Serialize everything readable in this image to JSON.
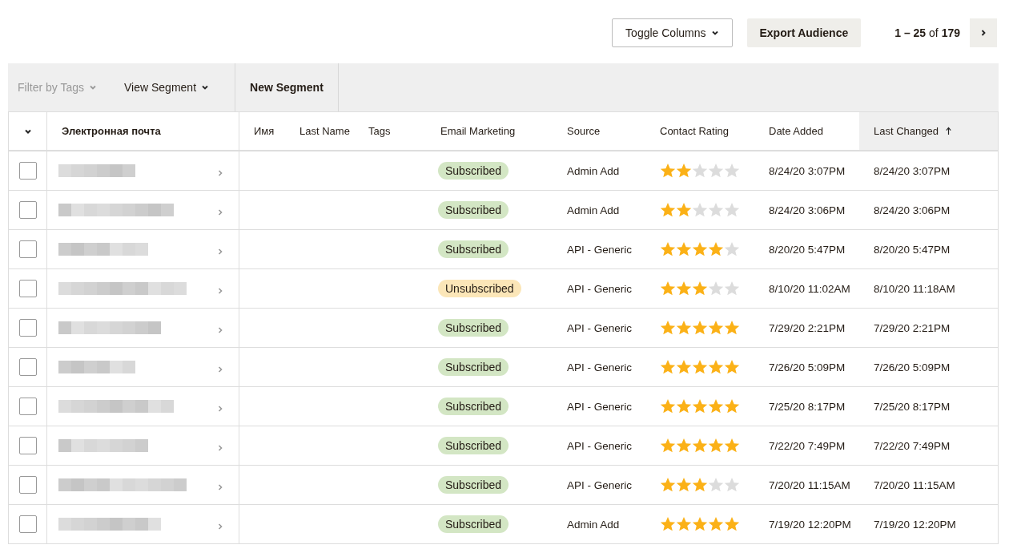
{
  "top_bar": {
    "toggle_columns": "Toggle Columns",
    "export": "Export Audience",
    "pagination": "**1 – 25** of **179**"
  },
  "toolbar": [
    {
      "label": "Filter by Tags",
      "disabled": true,
      "dropdown": true
    },
    {
      "label": "View Segment",
      "disabled": false,
      "dropdown": true
    },
    {
      "label": "New Segment",
      "disabled": false,
      "dropdown": false
    }
  ],
  "columns": [
    {
      "label": "Электронная почта",
      "sorted": false
    },
    {
      "label": "Имя",
      "sorted": false
    },
    {
      "label": "Last Name",
      "sorted": false
    },
    {
      "label": "Tags",
      "sorted": false
    },
    {
      "label": "Email Marketing",
      "sorted": false
    },
    {
      "label": "Source",
      "sorted": false
    },
    {
      "label": "Contact Rating",
      "sorted": false
    },
    {
      "label": "Date Added",
      "sorted": false
    },
    {
      "label": "Last Changed",
      "sorted": true
    }
  ],
  "rows": [
    {
      "checked": false,
      "status": "Subscribed",
      "color": "#d3e6c4",
      "source": "Admin Add",
      "stars": 2,
      "date_added": "8/24/20 3:07PM",
      "last_changed": "8/24/20 3:07PM"
    },
    {
      "checked": false,
      "status": "Subscribed",
      "color": "#d3e6c4",
      "source": "Admin Add",
      "stars": 2,
      "date_added": "8/24/20 3:06PM",
      "last_changed": "8/24/20 3:06PM"
    },
    {
      "checked": false,
      "status": "Subscribed",
      "color": "#d3e6c4",
      "source": "API - Generic",
      "stars": 4,
      "date_added": "8/20/20 5:47PM",
      "last_changed": "8/20/20 5:47PM"
    },
    {
      "checked": false,
      "status": "Unsubscribed",
      "color": "#fbe6b8",
      "source": "API - Generic",
      "stars": 3,
      "date_added": "8/10/20 11:02AM",
      "last_changed": "8/10/20 11:18AM"
    },
    {
      "checked": false,
      "status": "Subscribed",
      "color": "#d3e6c4",
      "source": "API - Generic",
      "stars": 5,
      "date_added": "7/29/20 2:21PM",
      "last_changed": "7/29/20 2:21PM"
    },
    {
      "checked": false,
      "status": "Subscribed",
      "color": "#d3e6c4",
      "source": "API - Generic",
      "stars": 5,
      "date_added": "7/26/20 5:09PM",
      "last_changed": "7/26/20 5:09PM"
    },
    {
      "checked": false,
      "status": "Subscribed",
      "color": "#d3e6c4",
      "source": "API - Generic",
      "stars": 5,
      "date_added": "7/25/20 8:17PM",
      "last_changed": "7/25/20 8:17PM"
    },
    {
      "checked": false,
      "status": "Subscribed",
      "color": "#d3e6c4",
      "source": "API - Generic",
      "stars": 5,
      "date_added": "7/22/20 7:49PM",
      "last_changed": "7/22/20 7:49PM"
    },
    {
      "checked": false,
      "status": "Subscribed",
      "color": "#d3e6c4",
      "source": "API - Generic",
      "stars": 3,
      "date_added": "7/20/20 11:15AM",
      "last_changed": "7/20/20 11:15AM"
    },
    {
      "checked": false,
      "status": "Subscribed",
      "color": "#d3e6c4",
      "source": "Admin Add",
      "stars": 5,
      "date_added": "7/19/20 12:20PM",
      "last_changed": "7/19/20 12:20PM"
    }
  ]
}
